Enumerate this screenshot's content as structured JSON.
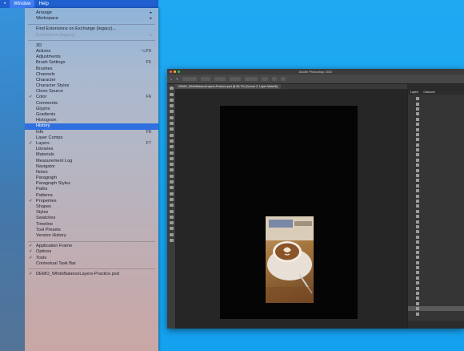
{
  "menubar": {
    "items": [
      "Window",
      "Help"
    ]
  },
  "window_menu": {
    "items": [
      {
        "label": "Arrange",
        "arrow": true
      },
      {
        "label": "Workspace",
        "arrow": true
      },
      {
        "sep": true
      },
      {
        "label": "Find Extensions on Exchange (legacy)..."
      },
      {
        "label": "Extensions (legacy)",
        "disabled": true,
        "arrow": true
      },
      {
        "sep": true
      },
      {
        "label": "3D"
      },
      {
        "label": "Actions",
        "shortcut": "⌥F9"
      },
      {
        "label": "Adjustments"
      },
      {
        "label": "Brush Settings",
        "shortcut": "F5"
      },
      {
        "label": "Brushes"
      },
      {
        "label": "Channels"
      },
      {
        "label": "Character"
      },
      {
        "label": "Character Styles"
      },
      {
        "label": "Clone Source"
      },
      {
        "label": "Color",
        "checked": true,
        "shortcut": "F6"
      },
      {
        "label": "Comments"
      },
      {
        "label": "Glyphs"
      },
      {
        "label": "Gradients"
      },
      {
        "label": "Histogram"
      },
      {
        "label": "History",
        "highlight": true
      },
      {
        "label": "Info",
        "shortcut": "F8"
      },
      {
        "label": "Layer Comps"
      },
      {
        "label": "Layers",
        "checked": true,
        "shortcut": "F7"
      },
      {
        "label": "Libraries"
      },
      {
        "label": "Materials"
      },
      {
        "label": "Measurement Log"
      },
      {
        "label": "Navigator"
      },
      {
        "label": "Notes"
      },
      {
        "label": "Paragraph"
      },
      {
        "label": "Paragraph Styles"
      },
      {
        "label": "Paths"
      },
      {
        "label": "Patterns"
      },
      {
        "label": "Properties",
        "checked": true
      },
      {
        "label": "Shapes"
      },
      {
        "label": "Styles"
      },
      {
        "label": "Swatches"
      },
      {
        "label": "Timeline"
      },
      {
        "label": "Tool Presets"
      },
      {
        "label": "Version History"
      },
      {
        "sep": true
      },
      {
        "label": "Application Frame",
        "checked": true
      },
      {
        "label": "Options",
        "checked": true
      },
      {
        "label": "Tools",
        "checked": true
      },
      {
        "label": "Contextual Task Bar"
      },
      {
        "sep": true
      },
      {
        "label": "DEMO_WhiteBalanceLayers-Practice.psd",
        "checked": true
      }
    ]
  },
  "photoshop": {
    "title": "Adobe Photoshop 2024",
    "doc_tab": "DEMO_WhiteBalanceLayers-Practice.psd @ 66.7% (Curves 2, Layer Mask/8)",
    "panel_tabs": [
      "Layers",
      "Channels"
    ],
    "traffic_lights": [
      "#ff5f57",
      "#febc2e",
      "#28c840"
    ]
  },
  "colors": {
    "desktop": "#14a1ef",
    "highlight": "#2f6fe0"
  }
}
